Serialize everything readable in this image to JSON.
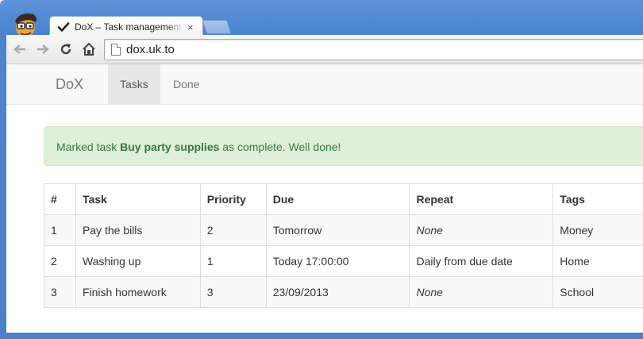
{
  "browser": {
    "tab_title": "DoX – Task management,",
    "tab_close": "×",
    "url": "dox.uk.to",
    "icons": {
      "back": "back-arrow-icon",
      "forward": "forward-arrow-icon",
      "reload": "reload-icon",
      "home": "home-icon",
      "page": "page-icon"
    }
  },
  "navbar": {
    "brand": "DoX",
    "links": [
      {
        "label": "Tasks",
        "active": true
      },
      {
        "label": "Done",
        "active": false
      }
    ]
  },
  "alert": {
    "prefix": "Marked task ",
    "task": "Buy party supplies",
    "suffix": " as complete. Well done!",
    "color": "#3c763d",
    "background": "#dff0d8"
  },
  "table": {
    "headers": [
      "#",
      "Task",
      "Priority",
      "Due",
      "Repeat",
      "Tags"
    ],
    "rows": [
      [
        "1",
        "Pay the bills",
        "2",
        "Tomorrow",
        "None",
        "Money"
      ],
      [
        "2",
        "Washing up",
        "1",
        "Today 17:00:00",
        "Daily from due date",
        "Home"
      ],
      [
        "3",
        "Finish homework",
        "3",
        "23/09/2013",
        "None",
        "School"
      ]
    ]
  }
}
